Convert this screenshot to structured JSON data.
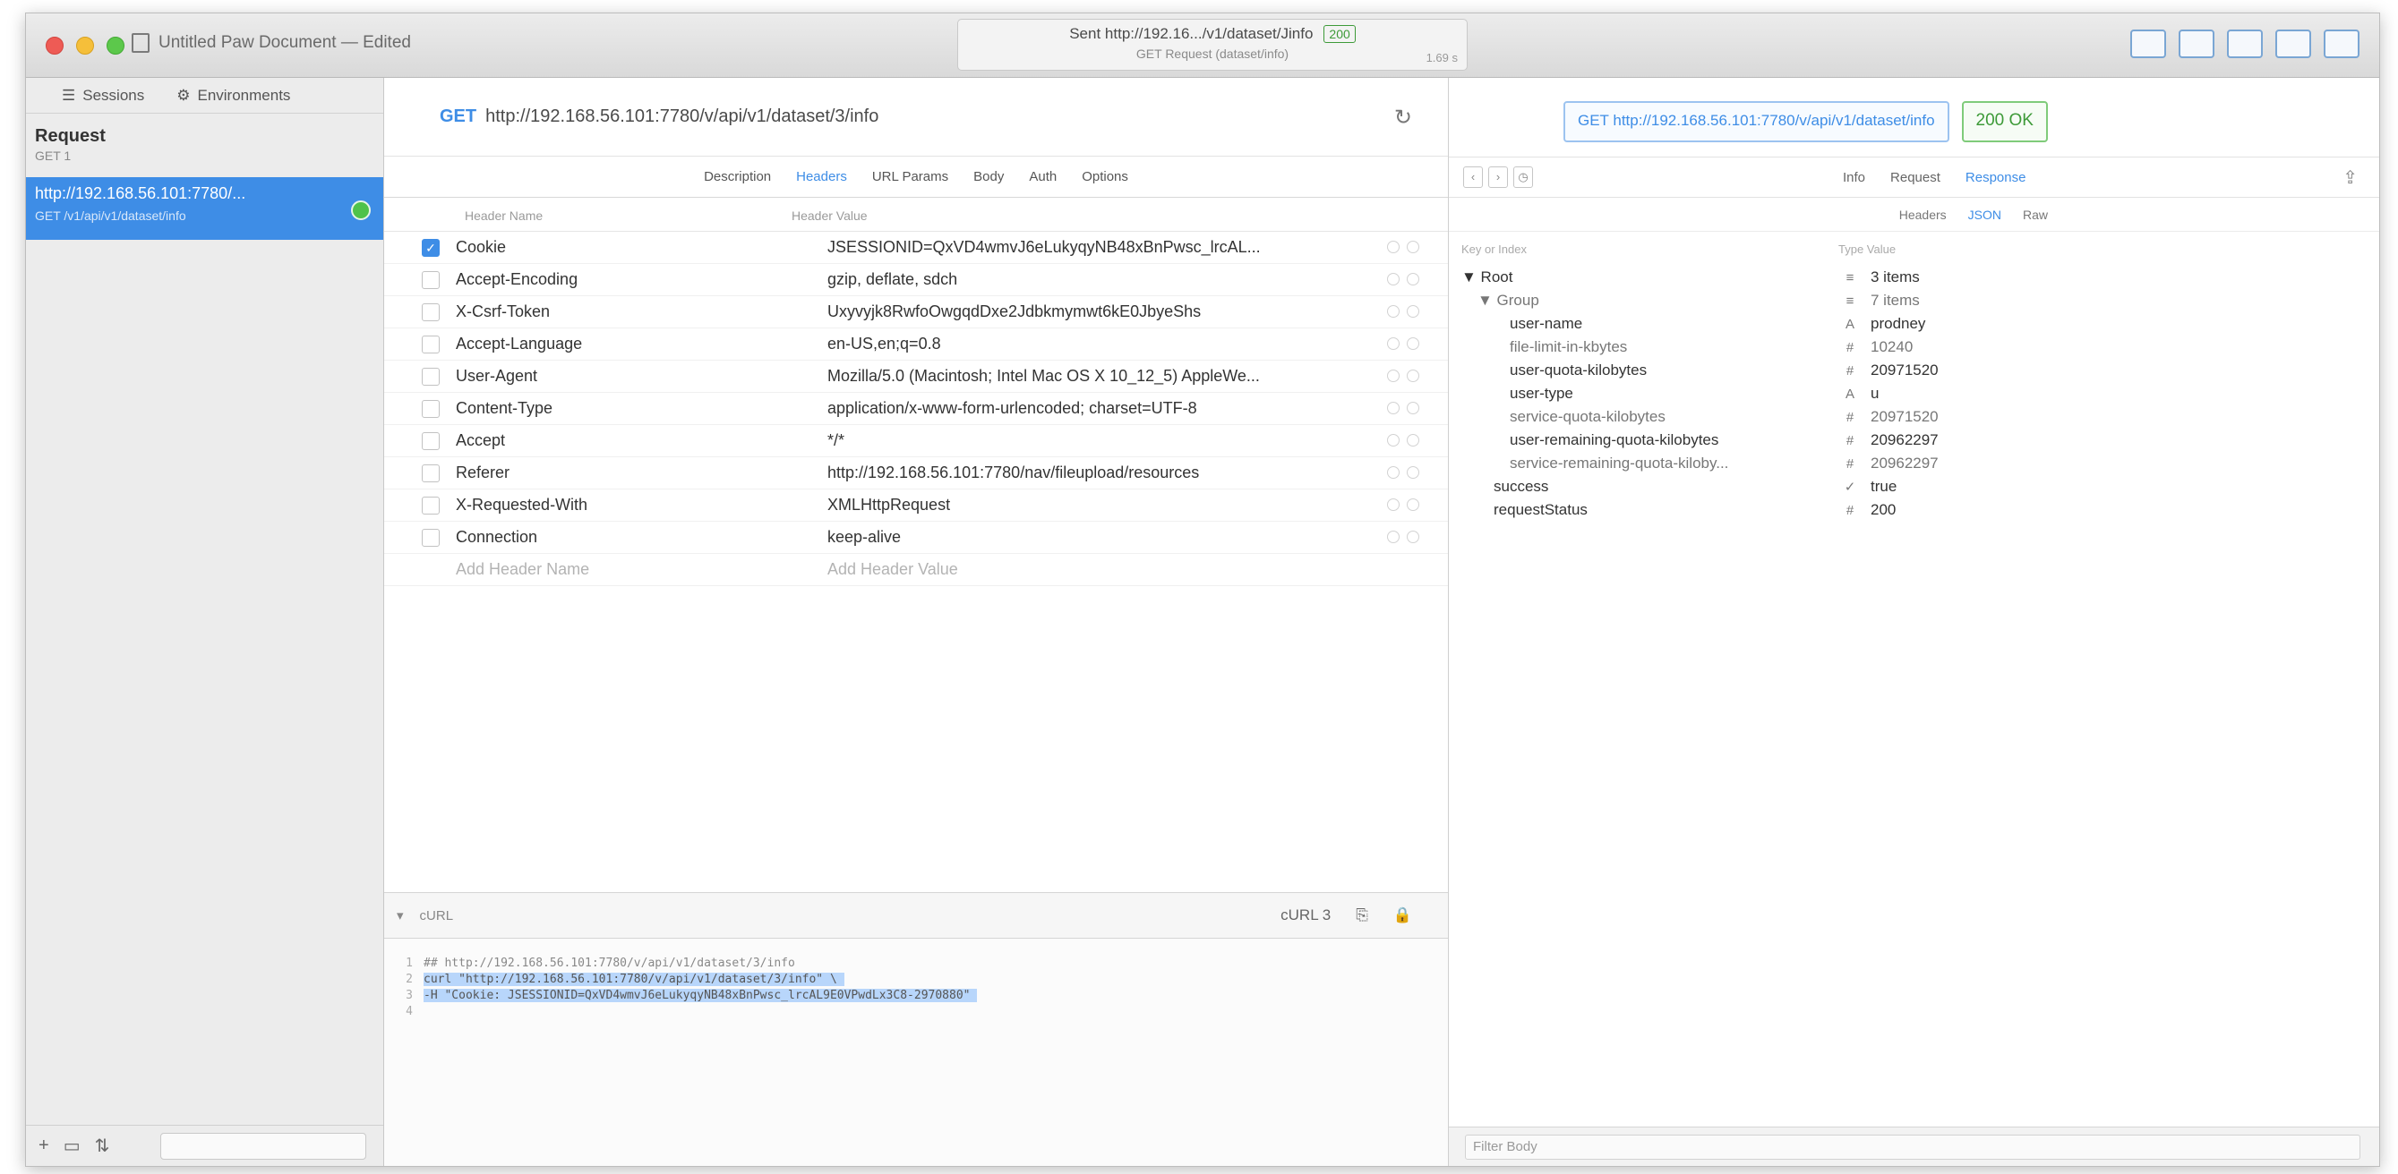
{
  "titlebar": {
    "document_title": "Untitled Paw Document — Edited",
    "activity_line1": "Sent http://192.16.../v1/dataset/Jinfo",
    "activity_code": "200",
    "activity_line2": "GET Request (dataset/info)",
    "activity_size": "1.69 s"
  },
  "sidebar": {
    "tabs": [
      "Sessions",
      "Environments"
    ],
    "heading": "Request",
    "subheading": "GET 1",
    "item_line1": "http://192.168.56.101:7780/...",
    "item_line2": "GET /v1/api/v1/dataset/info"
  },
  "request": {
    "method": "GET",
    "url": "http://192.168.56.101:7780/v/api/v1/dataset/3/info",
    "tabs": [
      "Description",
      "Headers",
      "URL Params",
      "Body",
      "Auth",
      "Options"
    ],
    "active_tab": "Headers",
    "col_name": "Header Name",
    "col_value": "Header Value",
    "headers": [
      {
        "name": "Cookie",
        "value": "JSESSIONID=QxVD4wmvJ6eLukyqyNB48xBnPwsc_lrcAL...",
        "checked": true
      },
      {
        "name": "Accept-Encoding",
        "value": "gzip, deflate, sdch",
        "checked": false
      },
      {
        "name": "X-Csrf-Token",
        "value": "Uxyvyjk8RwfoOwgqdDxe2Jdbkmymwt6kE0JbyeShs",
        "checked": false
      },
      {
        "name": "Accept-Language",
        "value": "en-US,en;q=0.8",
        "checked": false
      },
      {
        "name": "User-Agent",
        "value": "Mozilla/5.0 (Macintosh; Intel Mac OS X 10_12_5) AppleWe...",
        "checked": false
      },
      {
        "name": "Content-Type",
        "value": "application/x-www-form-urlencoded; charset=UTF-8",
        "checked": false
      },
      {
        "name": "Accept",
        "value": "*/*",
        "checked": false
      },
      {
        "name": "Referer",
        "value": "http://192.168.56.101:7780/nav/fileupload/resources",
        "checked": false
      },
      {
        "name": "X-Requested-With",
        "value": "XMLHttpRequest",
        "checked": false
      },
      {
        "name": "Connection",
        "value": "keep-alive",
        "checked": false
      }
    ],
    "add_name": "Add Header Name",
    "add_value": "Add Header Value"
  },
  "code": {
    "language": "cURL",
    "count": "cURL 3",
    "lines": [
      {
        "n": "1",
        "text": "## http://192.168.56.101:7780/v/api/v1/dataset/3/info",
        "sel": false
      },
      {
        "n": "2",
        "text": "curl \"http://192.168.56.101:7780/v/api/v1/dataset/3/info\" \\",
        "sel": true
      },
      {
        "n": "3",
        "text": "     -H \"Cookie: JSESSIONID=QxVD4wmvJ6eLukyqyNB48xBnPwsc_lrcAL9E0VPwdLx3C8-2970880\"",
        "sel": true
      },
      {
        "n": "4",
        "text": "",
        "sel": false
      }
    ]
  },
  "response": {
    "url": "GET http://192.168.56.101:7780/v/api/v1/dataset/info",
    "status": "200 OK",
    "tabs": [
      "Info",
      "Request",
      "Response"
    ],
    "active_tab": "Response",
    "format_tabs": [
      "Headers",
      "JSON",
      "Raw"
    ],
    "active_format": "JSON",
    "col_key": "Key or Index",
    "col_value": "Type Value",
    "tree": [
      {
        "key": "▼  Root",
        "type": "≡",
        "value": "3 items",
        "indent": 0,
        "dim": false
      },
      {
        "key": "▼  Group",
        "type": "≡",
        "value": "7 items",
        "indent": 1,
        "dim": true
      },
      {
        "key": "user-name",
        "type": "A",
        "value": "prodney",
        "indent": 3,
        "dim": false
      },
      {
        "key": "file-limit-in-kbytes",
        "type": "#",
        "value": "10240",
        "indent": 3,
        "dim": true
      },
      {
        "key": "user-quota-kilobytes",
        "type": "#",
        "value": "20971520",
        "indent": 3,
        "dim": false
      },
      {
        "key": "user-type",
        "type": "A",
        "value": "u",
        "indent": 3,
        "dim": false
      },
      {
        "key": "service-quota-kilobytes",
        "type": "#",
        "value": "20971520",
        "indent": 3,
        "dim": true
      },
      {
        "key": "user-remaining-quota-kilobytes",
        "type": "#",
        "value": "20962297",
        "indent": 3,
        "dim": false
      },
      {
        "key": "service-remaining-quota-kiloby...",
        "type": "#",
        "value": "20962297",
        "indent": 3,
        "dim": true
      },
      {
        "key": "success",
        "type": "✓",
        "value": "true",
        "indent": 2,
        "dim": false
      },
      {
        "key": "requestStatus",
        "type": "#",
        "value": "200",
        "indent": 2,
        "dim": false
      }
    ],
    "filter_placeholder": "Filter Body"
  }
}
